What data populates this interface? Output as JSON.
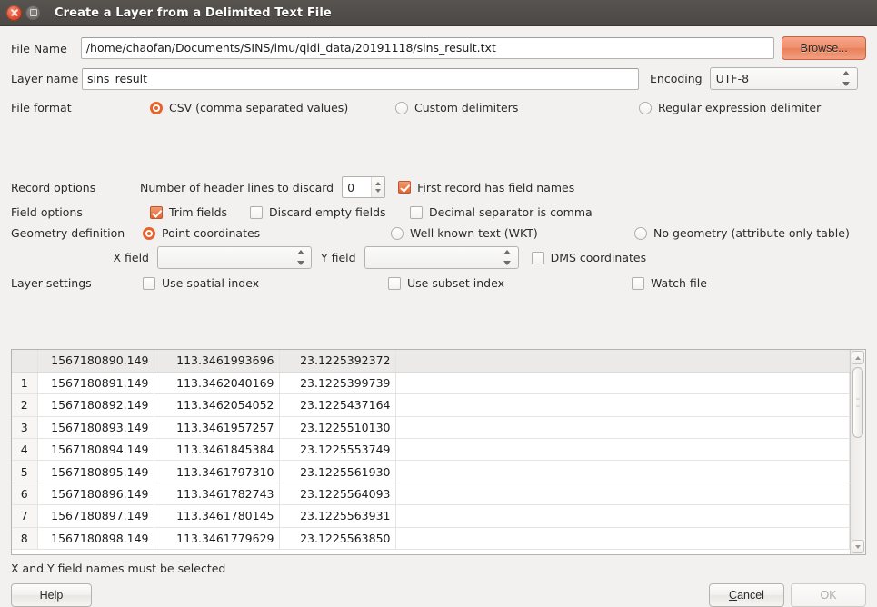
{
  "window": {
    "title": "Create a Layer from a Delimited Text File",
    "close_icon": "close-icon",
    "maximize_icon": "maximize-icon"
  },
  "file": {
    "label": "File Name",
    "value": "/home/chaofan/Documents/SINS/imu/qidi_data/20191118/sins_result.txt",
    "placeholder": "",
    "browse_label": "Browse..."
  },
  "layer": {
    "label": "Layer name",
    "value": "sins_result",
    "placeholder": ""
  },
  "encoding": {
    "label": "Encoding",
    "value": "UTF-8"
  },
  "file_format": {
    "label": "File format",
    "options": [
      {
        "label": "CSV (comma separated values)",
        "selected": true
      },
      {
        "label": "Custom delimiters",
        "selected": false
      },
      {
        "label": "Regular expression delimiter",
        "selected": false
      }
    ]
  },
  "record_options": {
    "label": "Record options",
    "header_lines_label": "Number of header lines to discard",
    "header_lines_value": "0",
    "first_record_label": "First record has field names",
    "first_record_checked": true
  },
  "field_options": {
    "label": "Field options",
    "items": [
      {
        "label": "Trim fields",
        "checked": true
      },
      {
        "label": "Discard empty fields",
        "checked": false
      },
      {
        "label": "Decimal separator is comma",
        "checked": false
      }
    ]
  },
  "geometry": {
    "label": "Geometry definition",
    "options": [
      {
        "label": "Point coordinates",
        "selected": true
      },
      {
        "label": "Well known text (WKT)",
        "selected": false
      },
      {
        "label": "No geometry (attribute only table)",
        "selected": false
      }
    ],
    "x_field_label": "X field",
    "x_field_value": "",
    "y_field_label": "Y field",
    "y_field_value": "",
    "dms_label": "DMS coordinates",
    "dms_checked": false
  },
  "layer_settings": {
    "label": "Layer settings",
    "items": [
      {
        "label": "Use spatial index",
        "checked": false
      },
      {
        "label": "Use subset index",
        "checked": false
      },
      {
        "label": "Watch file",
        "checked": false
      }
    ]
  },
  "preview_table": {
    "header_row": {
      "index": "",
      "cells": [
        "1567180890.149",
        "113.3461993696",
        "23.1225392372"
      ]
    },
    "rows": [
      {
        "index": "1",
        "cells": [
          "1567180891.149",
          "113.3462040169",
          "23.1225399739"
        ]
      },
      {
        "index": "2",
        "cells": [
          "1567180892.149",
          "113.3462054052",
          "23.1225437164"
        ]
      },
      {
        "index": "3",
        "cells": [
          "1567180893.149",
          "113.3461957257",
          "23.1225510130"
        ]
      },
      {
        "index": "4",
        "cells": [
          "1567180894.149",
          "113.3461845384",
          "23.1225553749"
        ]
      },
      {
        "index": "5",
        "cells": [
          "1567180895.149",
          "113.3461797310",
          "23.1225561930"
        ]
      },
      {
        "index": "6",
        "cells": [
          "1567180896.149",
          "113.3461782743",
          "23.1225564093"
        ]
      },
      {
        "index": "7",
        "cells": [
          "1567180897.149",
          "113.3461780145",
          "23.1225563931"
        ]
      },
      {
        "index": "8",
        "cells": [
          "1567180898.149",
          "113.3461779629",
          "23.1225563850"
        ]
      }
    ]
  },
  "status": {
    "message": "X and Y field names must be selected"
  },
  "buttons": {
    "help": "Help",
    "cancel_mnemonic": "C",
    "cancel_rest": "ancel",
    "ok": "OK",
    "ok_enabled": false
  },
  "colors": {
    "accent": "#e8632c",
    "titlebar": "#4f4b48",
    "dialog_bg": "#f2f1f0"
  }
}
